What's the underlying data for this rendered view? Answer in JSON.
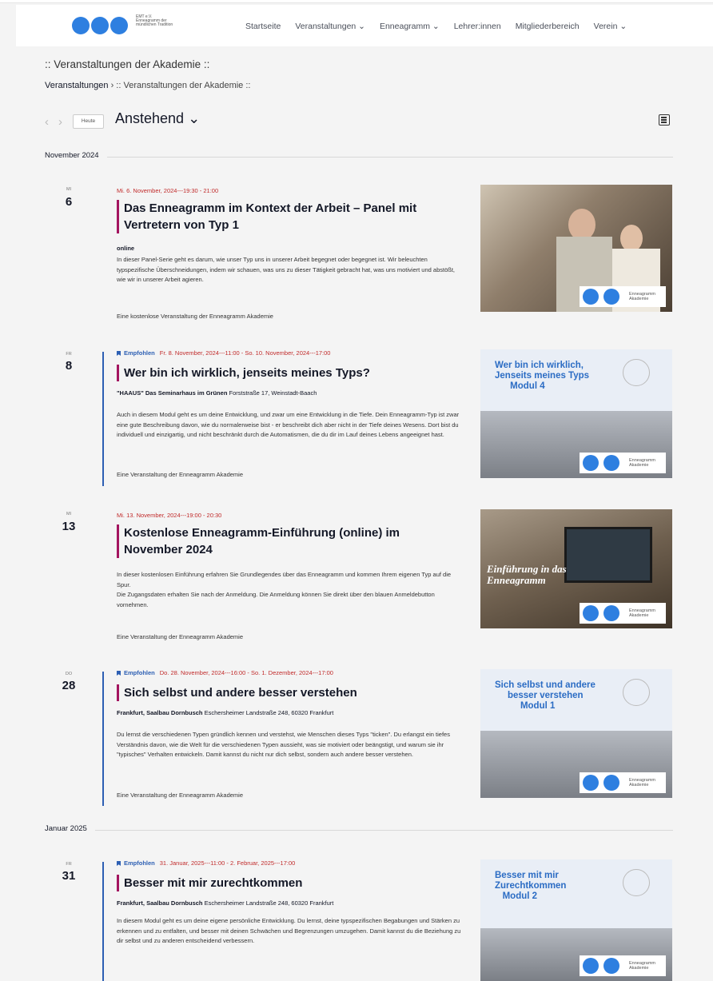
{
  "logo": {
    "text": "EMT e.V. Enneagramm der mündlichen Tradition"
  },
  "nav": [
    {
      "label": "Startseite"
    },
    {
      "label": "Veranstaltungen ⌄"
    },
    {
      "label": "Enneagramm ⌄"
    },
    {
      "label": "Lehrer:innen"
    },
    {
      "label": "Mitgliederbereich"
    },
    {
      "label": "Verein ⌄"
    }
  ],
  "page_title": ":: Veranstaltungen der Akademie ::",
  "breadcrumb": {
    "link": "Veranstaltungen",
    "sep": " › ",
    "current": ":: Veranstaltungen der Akademie ::"
  },
  "toolbar": {
    "prev": "‹",
    "next": "›",
    "today": "Heute",
    "view": "Anstehend ⌄"
  },
  "months": [
    {
      "label": "November 2024"
    },
    {
      "label": "Januar 2025"
    }
  ],
  "featured_label": "Empfohlen",
  "events": [
    {
      "dow": "MI",
      "day": "6",
      "featured": false,
      "datetime": "Mi. 6. November, 2024---19:30 - 21:00",
      "title": "Das Enneagramm im Kontext der Arbeit – Panel mit Vertretern von Typ 1",
      "venue_name": "online",
      "venue_addr": "",
      "description": "In dieser Panel-Serie geht es darum, wie unser Typ uns in unserer Arbeit begegnet oder begegnet ist. Wir beleuchten typspezifische Überschneidungen, indem wir schauen, was uns zu dieser Tätigkeit gebracht hat, was uns motiviert und abstößt, wie wir in unserer Arbeit agieren.",
      "note": "Eine kostenlose Veranstaltung der Enneagramm Akademie",
      "image_text": "",
      "badge": "Enneagramm Akademie",
      "image_bg": "#5a4a3a"
    },
    {
      "dow": "FR",
      "day": "8",
      "featured": true,
      "datetime": "Fr. 8. November, 2024---11:00 - So. 10. November, 2024---17:00",
      "title": "Wer bin ich wirklich, jenseits meines Typs?",
      "venue_name": "\"HAAUS\" Das Seminarhaus im Grünen",
      "venue_addr": " Forststraße 17, Weinstadt-Baach",
      "description": "Auch in diesem Modul geht es um deine Entwicklung, und zwar um eine Entwicklung in die Tiefe. Dein Enneagramm-Typ ist zwar eine gute Beschreibung davon, wie du normalerweise bist - er beschreibt dich aber nicht in der Tiefe deines Wesens. Dort bist du individuell und einzigartig, und nicht beschränkt durch die Automatismen, die du dir im Lauf deines Lebens angeeignet hast.",
      "note": "Eine Veranstaltung der Enneagramm Akademie",
      "image_text": "Wer bin ich wirklich,\nJenseits meines Typs\n      Modul 4",
      "badge": "Enneagramm Akademie",
      "image_bg": "#e9eef6"
    },
    {
      "dow": "MI",
      "day": "13",
      "featured": false,
      "datetime": "Mi. 13. November, 2024---19:00 - 20:30",
      "title": "Kostenlose Enneagramm-Einführung (online) im November 2024",
      "venue_name": "",
      "venue_addr": "",
      "description": "In dieser kostenlosen Einführung erfahren Sie Grundlegendes über das Enneagramm und kommen Ihrem eigenen Typ auf die Spur.\nDie Zugangsdaten erhalten Sie nach der Anmeldung. Die Anmeldung können Sie direkt über den blauen Anmeldebutton vornehmen.",
      "note": "Eine Veranstaltung der Enneagramm Akademie",
      "image_text": "Einführung in das\nEnneagramm",
      "badge": "Enneagramm Akademie",
      "image_bg": "#6b5b4b"
    },
    {
      "dow": "DO",
      "day": "28",
      "featured": true,
      "datetime": "Do. 28. November, 2024---16:00 - So. 1. Dezember, 2024---17:00",
      "title": "Sich selbst und andere besser verstehen",
      "venue_name": "Frankfurt, Saalbau Dornbusch",
      "venue_addr": " Eschersheimer Landstraße 248, 60320 Frankfurt",
      "description": "Du lernst die verschiedenen Typen gründlich kennen und verstehst, wie Menschen dieses Typs \"ticken\". Du erlangst ein tiefes Verständnis davon, wie die Welt für die verschiedenen Typen aussieht, was sie motiviert oder beängstigt, und warum sie ihr \"typisches\" Verhalten entwickeln. Damit kannst du nicht nur dich selbst, sondern auch andere besser verstehen.",
      "note": "Eine Veranstaltung der Enneagramm Akademie",
      "image_text": "Sich selbst und andere\n     besser verstehen\n          Modul 1",
      "badge": "Enneagramm Akademie",
      "image_bg": "#e9eef6"
    },
    {
      "dow": "FR",
      "day": "31",
      "featured": true,
      "datetime": "31. Januar, 2025---11:00 - 2. Februar, 2025---17:00",
      "title": "Besser mit mir zurechtkommen",
      "venue_name": "Frankfurt, Saalbau Dornbusch",
      "venue_addr": " Eschersheimer Landstraße 248, 60320 Frankfurt",
      "description": "In diesem Modul geht es um deine eigene persönliche Entwicklung. Du lernst, deine typspezifischen Begabungen und Stärken zu erkennen und zu entfalten, und besser mit deinen Schwächen und Begrenzungen umzugehen. Damit kannst du die Beziehung zu dir selbst und zu anderen entscheidend verbessern.",
      "note": "",
      "image_text": "Besser mit mir\nZurechtkommen\n   Modul 2",
      "badge": "Enneagramm Akademie",
      "image_bg": "#e9eef6"
    }
  ]
}
